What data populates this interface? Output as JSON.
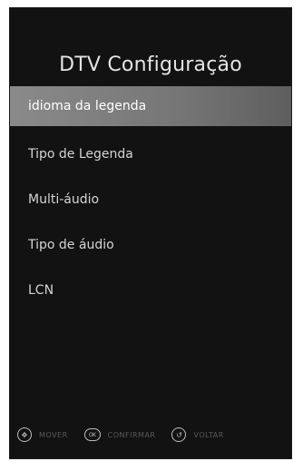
{
  "header": {
    "title": "DTV Configuração"
  },
  "menu": {
    "items": [
      {
        "label": "idioma da legenda",
        "selected": true
      },
      {
        "label": "Tipo de Legenda"
      },
      {
        "label": "Multi-áudio"
      },
      {
        "label": "Tipo de áudio"
      },
      {
        "label": "LCN"
      }
    ]
  },
  "footer": {
    "hints": [
      {
        "icon": "dpad-icon",
        "label": "MOVER"
      },
      {
        "icon": "ok-icon",
        "label": "CONFIRMAR"
      },
      {
        "icon": "back-icon",
        "label": "VOLTAR"
      }
    ]
  },
  "colors": {
    "panel_background": "#121212",
    "selection_highlight": "#7f7f7f",
    "text": "#d4d4d4"
  }
}
